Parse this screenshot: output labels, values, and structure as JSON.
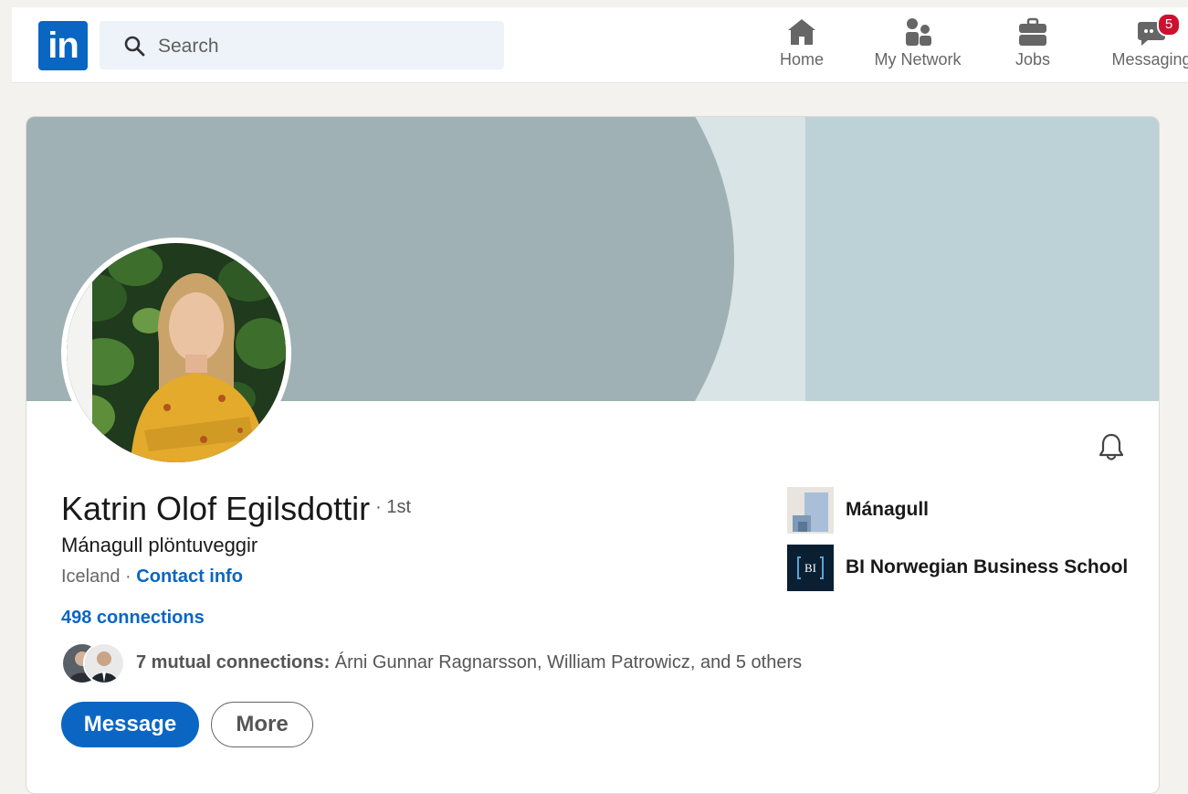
{
  "nav": {
    "logo_text": "in",
    "search_placeholder": "Search",
    "items": [
      {
        "label": "Home",
        "icon": "home-icon"
      },
      {
        "label": "My Network",
        "icon": "network-icon"
      },
      {
        "label": "Jobs",
        "icon": "briefcase-icon"
      },
      {
        "label": "Messaging",
        "icon": "messaging-icon",
        "badge": "5"
      }
    ]
  },
  "profile": {
    "name": "Katrin Olof Egilsdottir",
    "degree": "· 1st",
    "headline": "Mánagull plöntuveggir",
    "location": "Iceland",
    "separator": " · ",
    "contact_info": "Contact info",
    "connections": "498 connections",
    "mutual": {
      "count_label": "7 mutual connections:",
      "names": " Árni Gunnar Ragnarsson, William Patrowicz, and 5 others"
    },
    "actions": {
      "message": "Message",
      "more": "More"
    },
    "organizations": [
      {
        "name": "Mánagull",
        "logo": "managull-logo"
      },
      {
        "name": "BI Norwegian Business School",
        "logo": "bi-logo",
        "logo_text": "BI"
      }
    ]
  },
  "colors": {
    "brand": "#0a66c2",
    "badge": "#cb112d",
    "banner_light": "#bdd2d6",
    "banner_dark": "#9fb1b4"
  }
}
